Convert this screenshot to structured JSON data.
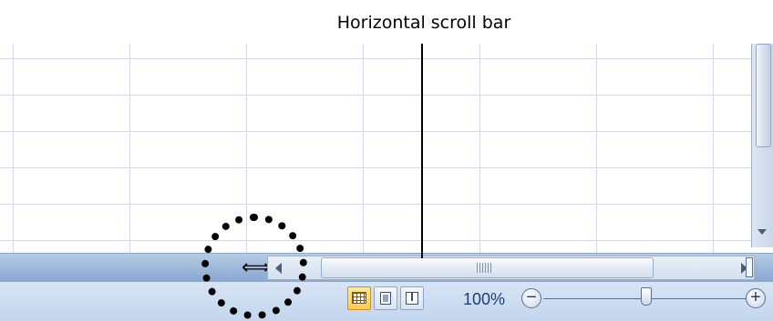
{
  "annotation": {
    "label": "Horizontal scroll bar"
  },
  "status_bar": {
    "view_buttons": [
      {
        "name": "Normal",
        "icon": "normal-view-icon",
        "active": true
      },
      {
        "name": "Page Layout",
        "icon": "page-layout-view-icon",
        "active": false
      },
      {
        "name": "Page Break Preview",
        "icon": "page-break-preview-icon",
        "active": false
      }
    ],
    "zoom": {
      "level": "100%",
      "minus_label": "−",
      "plus_label": "+"
    }
  },
  "scrollbars": {
    "tab_split_icon": "split-resize-icon",
    "left_arrow_icon": "arrow-left-icon",
    "right_arrow_icon": "arrow-right-icon",
    "vertical_down_arrow_icon": "arrow-down-icon"
  },
  "colors": {
    "grid_line": "#d3d8e6",
    "scroll_bar_blue": "#9cb6d9",
    "active_view_button": "#ffca4f",
    "zoom_text": "#1f3e74"
  }
}
